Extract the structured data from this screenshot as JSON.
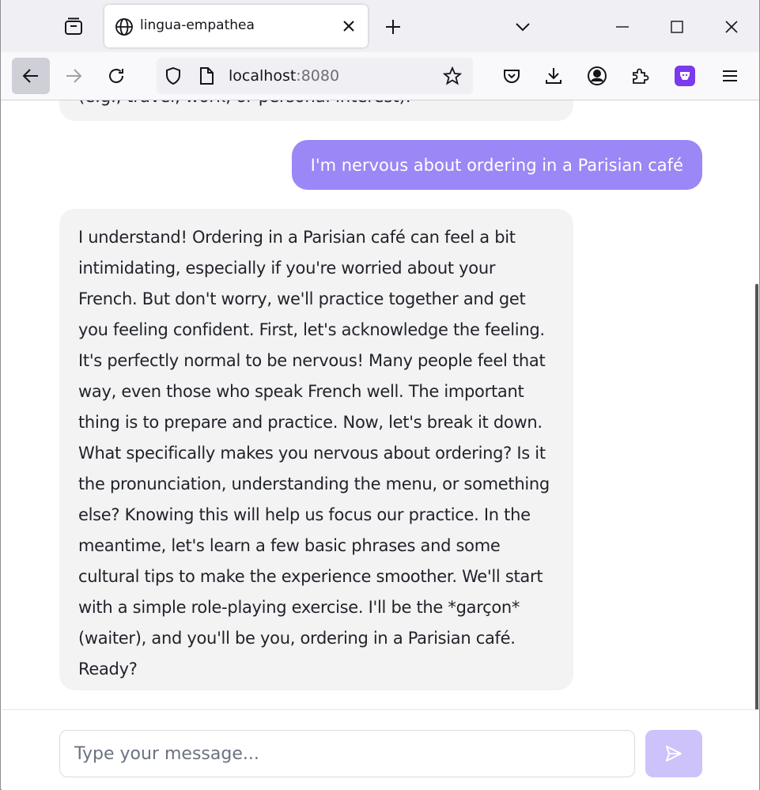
{
  "browser": {
    "tab_title": "lingua-empathea",
    "url_host": "localhost",
    "url_port": ":8080"
  },
  "chat": {
    "partial_message": "(e.g., travel, work, or personal interest).",
    "user_message": "I'm nervous about ordering in a Parisian café",
    "bot_message": "I understand! Ordering in a Parisian café can feel a bit intimidating, especially if you're worried about your French. But don't worry, we'll practice together and get you feeling confident. First, let's acknowledge the feeling. It's perfectly normal to be nervous! Many people feel that way, even those who speak French well. The important thing is to prepare and practice. Now, let's break it down. What specifically makes you nervous about ordering? Is it the pronunciation, understanding the menu, or something else? Knowing this will help us focus our practice. In the meantime, let's learn a few basic phrases and some cultural tips to make the experience smoother. We'll start with a simple role-playing exercise. I'll be the *garçon* (waiter), and you'll be you, ordering in a Parisian café. Ready?"
  },
  "composer": {
    "placeholder": "Type your message...",
    "value": ""
  },
  "colors": {
    "user_bubble": "#9b87f5",
    "bot_bubble": "#f3f3f4",
    "send_button": "#cdc3fa",
    "addon_badge": "#7c3aed"
  },
  "icons": {
    "tab_list": "tab-list-icon",
    "favicon": "globe-icon",
    "back": "arrow-left-icon",
    "forward": "arrow-right-icon",
    "reload": "reload-icon",
    "shield": "shield-icon",
    "page": "page-icon",
    "bookmark": "star-icon",
    "pocket": "pocket-icon",
    "downloads": "download-icon",
    "account": "account-icon",
    "extensions": "puzzle-icon",
    "addon": "addon-icon",
    "menu": "hamburger-icon",
    "send": "send-icon"
  }
}
